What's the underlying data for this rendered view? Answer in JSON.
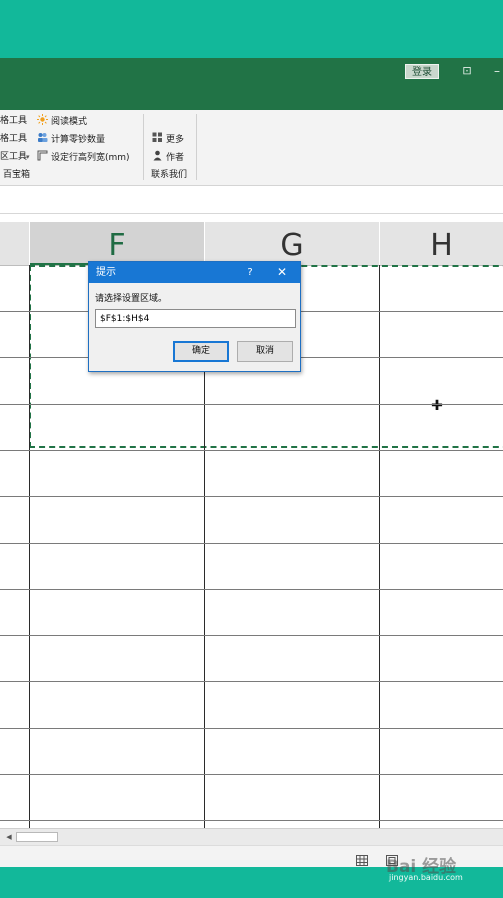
{
  "window": {
    "login_label": "登录"
  },
  "ribbon": {
    "col1": [
      "格工具",
      "格工具",
      "区工具"
    ],
    "col2": [
      "阅读模式",
      "计算零钞数量",
      "设定行高列宽(mm)"
    ],
    "col3": [
      "更多",
      "作者"
    ],
    "group_label_left": "百宝箱",
    "group_label_right": "联系我们"
  },
  "columns": [
    "F",
    "G",
    "H"
  ],
  "selected_column": "F",
  "dialog": {
    "title": "提示",
    "help": "?",
    "close": "✕",
    "prompt": "请选择设置区域。",
    "input_value": "$F$1:$H$4",
    "ok_label": "确定",
    "cancel_label": "取消"
  },
  "watermark": {
    "logo": "Bai 经验",
    "url": "jingyan.baidu.com"
  },
  "colors": {
    "background": "#12b89a",
    "title_bar": "#217346",
    "dialog_title": "#1877d4"
  }
}
